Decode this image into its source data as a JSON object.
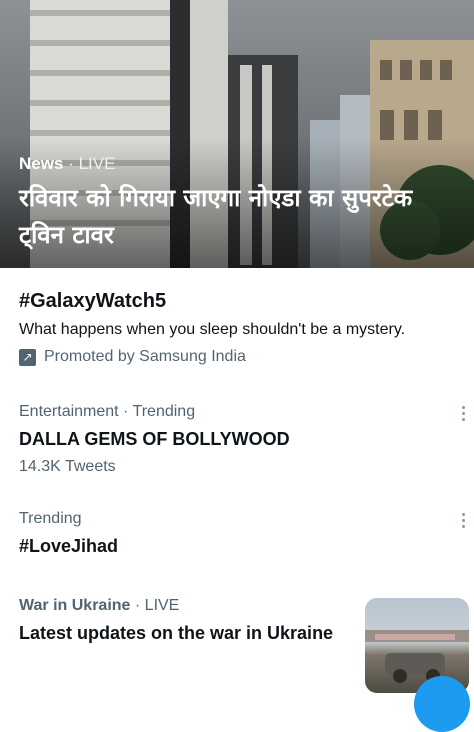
{
  "hero": {
    "category": "News",
    "separator": "·",
    "live": "LIVE",
    "title": "रविवार को गिराया जाएगा नोएडा का सुपरटेक ट्विन टावर"
  },
  "promoted": {
    "hashtag": "#GalaxyWatch5",
    "description": "What happens when you sleep shouldn't be a mystery.",
    "promoted_by": "Promoted by Samsung India",
    "icon": "promoted-arrow-icon"
  },
  "trends": [
    {
      "context": "Entertainment · Trending",
      "title": "DALLA GEMS OF BOLLYWOOD",
      "count": "14.3K Tweets"
    },
    {
      "context": "Trending",
      "title": "#LoveJihad"
    }
  ],
  "news_item": {
    "category": "War in Ukraine",
    "live": "· LIVE",
    "title": "Latest updates on the war in Ukraine"
  },
  "colors": {
    "accent": "#1d9bf0",
    "secondary_text": "#536471",
    "primary_text": "#0f1419"
  }
}
